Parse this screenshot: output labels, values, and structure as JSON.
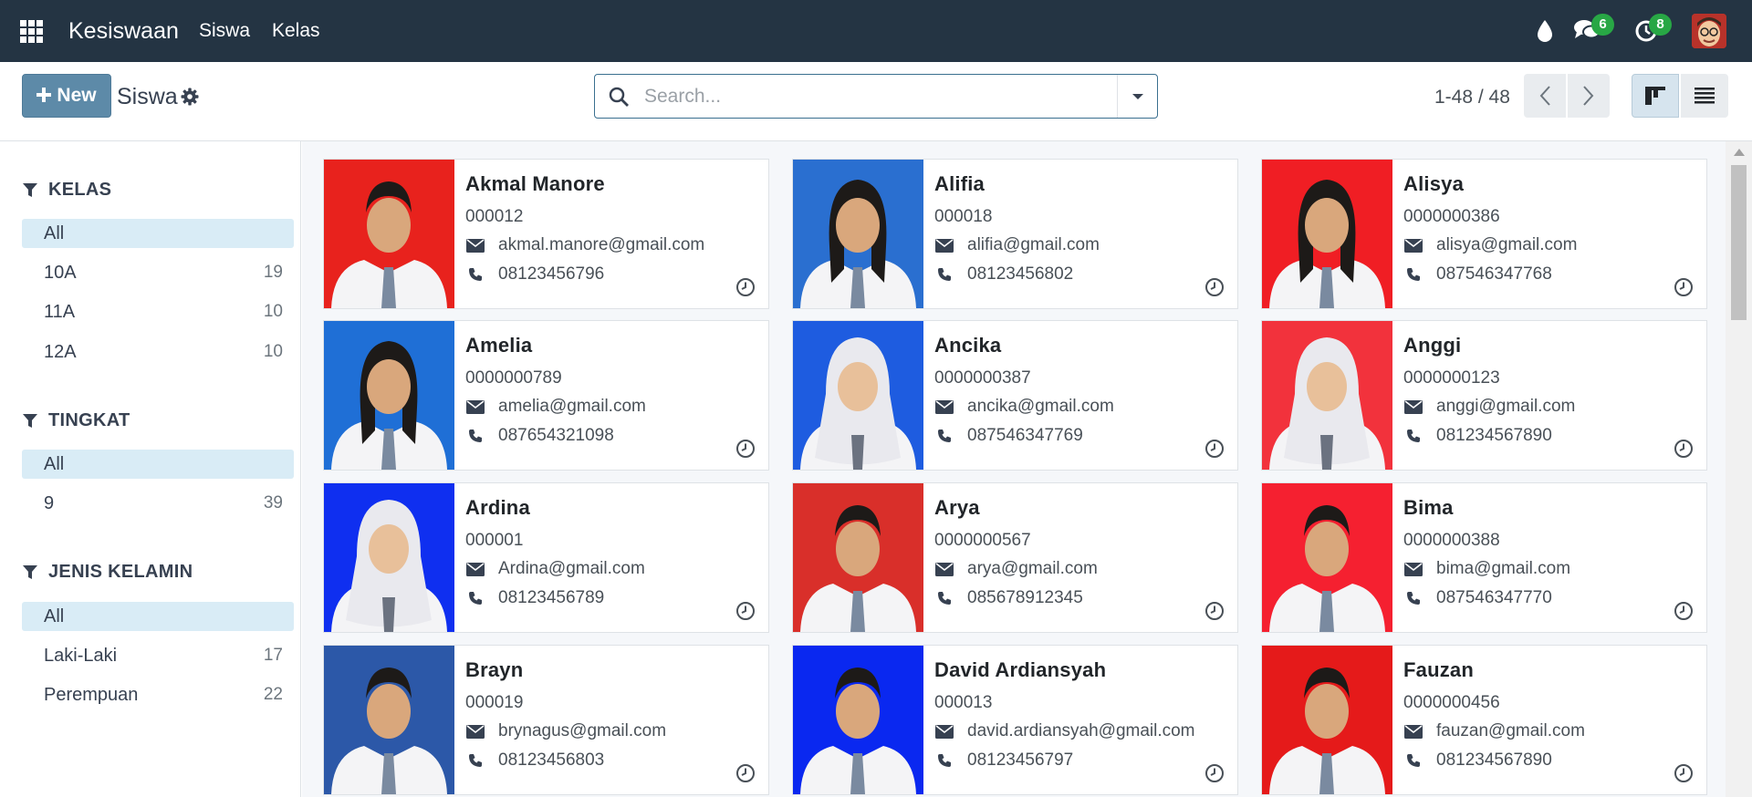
{
  "navbar": {
    "brand": "Kesiswaan",
    "links": [
      "Siswa",
      "Kelas"
    ],
    "messages_badge": "6",
    "activity_badge": "8",
    "bg_color": "#243443",
    "badge_color": "#28a745"
  },
  "control": {
    "new_label": "New",
    "breadcrumb": "Siswa",
    "search_placeholder": "Search...",
    "pager": "1-48 / 48"
  },
  "sidebar": {
    "groups": [
      {
        "title": "KELAS",
        "items": [
          {
            "label": "All",
            "count": ""
          },
          {
            "label": "10A",
            "count": "19"
          },
          {
            "label": "11A",
            "count": "10"
          },
          {
            "label": "12A",
            "count": "10"
          }
        ]
      },
      {
        "title": "TINGKAT",
        "items": [
          {
            "label": "All",
            "count": ""
          },
          {
            "label": "9",
            "count": "39"
          }
        ]
      },
      {
        "title": "JENIS KELAMIN",
        "items": [
          {
            "label": "All",
            "count": ""
          },
          {
            "label": "Laki-Laki",
            "count": "17"
          },
          {
            "label": "Perempuan",
            "count": "22"
          }
        ]
      }
    ]
  },
  "cards": [
    {
      "name": "Akmal Manore",
      "nis": "000012",
      "email": "akmal.manore@gmail.com",
      "phone": "08123456796",
      "bg": "#e8221d",
      "gender": "m"
    },
    {
      "name": "Alifia",
      "nis": "000018",
      "email": "alifia@gmail.com",
      "phone": "08123456802",
      "bg": "#2a6fd0",
      "gender": "f"
    },
    {
      "name": "Alisya",
      "nis": "0000000386",
      "email": "alisya@gmail.com",
      "phone": "087546347768",
      "bg": "#f01e24",
      "gender": "f"
    },
    {
      "name": "Amelia",
      "nis": "0000000789",
      "email": "amelia@gmail.com",
      "phone": "087654321098",
      "bg": "#1f6fd6",
      "gender": "f"
    },
    {
      "name": "Ancika",
      "nis": "0000000387",
      "email": "ancika@gmail.com",
      "phone": "087546347769",
      "bg": "#1e5ce0",
      "gender": "h"
    },
    {
      "name": "Anggi",
      "nis": "0000000123",
      "email": "anggi@gmail.com",
      "phone": "081234567890",
      "bg": "#f2323c",
      "gender": "h"
    },
    {
      "name": "Ardina",
      "nis": "000001",
      "email": "Ardina@gmail.com",
      "phone": "08123456789",
      "bg": "#0f2ff0",
      "gender": "h"
    },
    {
      "name": "Arya",
      "nis": "0000000567",
      "email": "arya@gmail.com",
      "phone": "085678912345",
      "bg": "#d92f2a",
      "gender": "m"
    },
    {
      "name": "Bima",
      "nis": "0000000388",
      "email": "bima@gmail.com",
      "phone": "087546347770",
      "bg": "#f52030",
      "gender": "m"
    },
    {
      "name": "Brayn",
      "nis": "000019",
      "email": "brynagus@gmail.com",
      "phone": "08123456803",
      "bg": "#2c58a8",
      "gender": "m"
    },
    {
      "name": "David Ardiansyah",
      "nis": "000013",
      "email": "david.ardiansyah@gmail.com",
      "phone": "08123456797",
      "bg": "#0a28f0",
      "gender": "m"
    },
    {
      "name": "Fauzan",
      "nis": "0000000456",
      "email": "fauzan@gmail.com",
      "phone": "081234567890",
      "bg": "#e51a1a",
      "gender": "m"
    }
  ]
}
